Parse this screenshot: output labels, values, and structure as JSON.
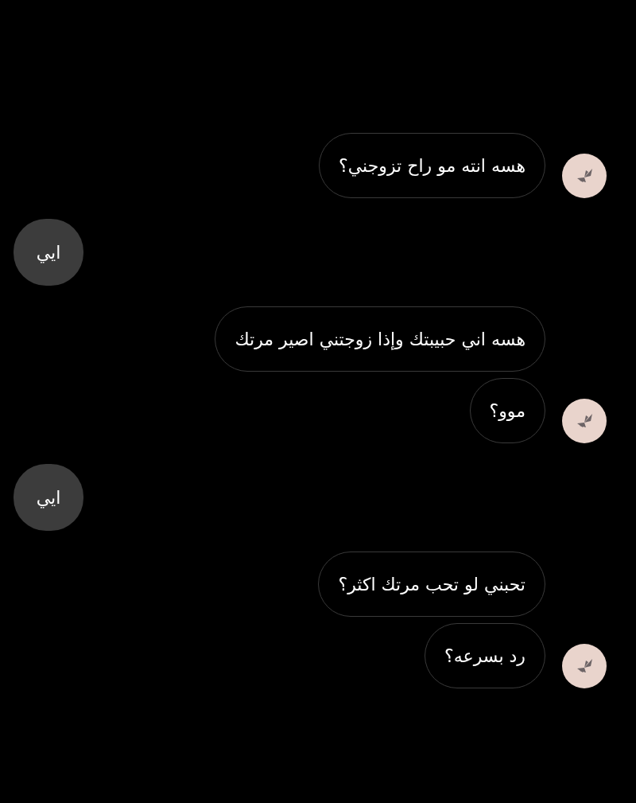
{
  "messages": [
    {
      "kind": "incoming",
      "text": "هسه انته مو راح تزوجني؟",
      "avatar": true
    },
    {
      "kind": "outgoing",
      "text": "ايي"
    },
    {
      "kind": "incoming",
      "text": "هسه اني حبيبتك وإذا زوجتني اصير مرتك",
      "avatar": false
    },
    {
      "kind": "incoming",
      "text": "موو؟",
      "avatar": true
    },
    {
      "kind": "outgoing",
      "text": "ايي"
    },
    {
      "kind": "incoming",
      "text": "تحبني لو تحب مرتك اكثر؟",
      "avatar": false
    },
    {
      "kind": "incoming",
      "text": "رد بسرعه؟",
      "avatar": true
    }
  ]
}
